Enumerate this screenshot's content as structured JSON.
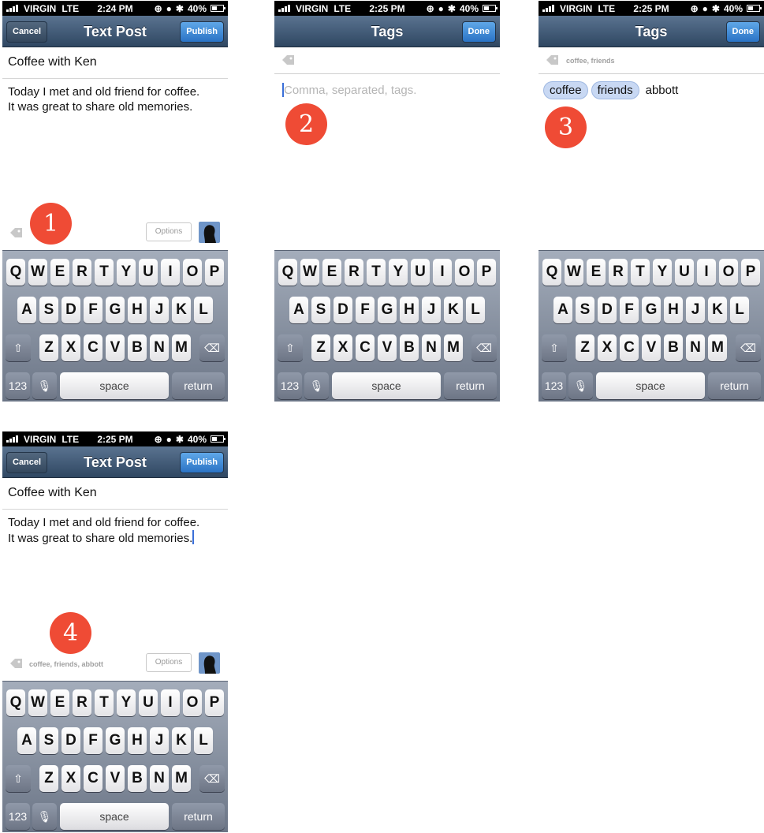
{
  "status": {
    "carrier": "VIRGIN",
    "network": "LTE",
    "battery": "40%",
    "times": [
      "2:24 PM",
      "2:25 PM",
      "2:25 PM",
      "2:25 PM"
    ]
  },
  "post_screen": {
    "title": "Text Post",
    "cancel_label": "Cancel",
    "publish_label": "Publish",
    "subject": "Coffee with Ken",
    "body": "Today I met and old friend for coffee.\nIt was great to share old memories.",
    "options_label": "Options",
    "tags_summary": "coffee, friends, abbott"
  },
  "tags_screen": {
    "title": "Tags",
    "done_label": "Done",
    "placeholder": "Comma, separated, tags.",
    "summary": "coffee, friends",
    "chips": [
      "coffee",
      "friends"
    ],
    "typing": "abbott"
  },
  "badges": [
    "1",
    "2",
    "3",
    "4"
  ],
  "keyboard": {
    "row1": [
      "Q",
      "W",
      "E",
      "R",
      "T",
      "Y",
      "U",
      "I",
      "O",
      "P"
    ],
    "row2": [
      "A",
      "S",
      "D",
      "F",
      "G",
      "H",
      "J",
      "K",
      "L"
    ],
    "row3": [
      "Z",
      "X",
      "C",
      "V",
      "B",
      "N",
      "M"
    ],
    "numbers_label": "123",
    "space_label": "space",
    "return_label": "return"
  },
  "icons": [
    "signal-icon",
    "orientation-lock-icon",
    "alarm-icon",
    "bluetooth-icon",
    "battery-icon",
    "tag-icon",
    "avatar-icon",
    "shift-icon",
    "delete-icon",
    "mic-icon"
  ],
  "colors": {
    "nav_top": "#5a7390",
    "nav_bottom": "#2f4762",
    "publish": "#2a73c5",
    "badge": "#ef4b35",
    "chip": "#c8d8f3",
    "caret": "#3a6fd8"
  }
}
